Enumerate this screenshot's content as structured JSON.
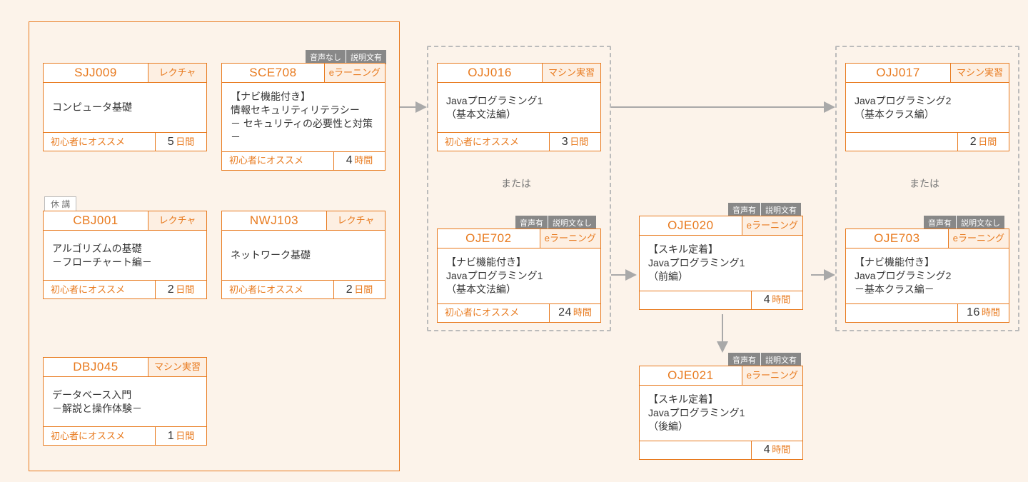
{
  "labels": {
    "or": "または",
    "suspended": "休 講",
    "recommended": "初心者にオススメ"
  },
  "badges": {
    "audio_no": "音声なし",
    "audio_yes": "音声有",
    "desc_yes": "説明文有",
    "desc_no": "説明文なし"
  },
  "units": {
    "days": "日間",
    "hours": "時間"
  },
  "types": {
    "lecture": "レクチャ",
    "elearning": "eラーニング",
    "machine": "マシン実習"
  },
  "courses": {
    "sjj009": {
      "code": "SJJ009",
      "type": "lecture",
      "title": "コンピュータ基礎",
      "rec": true,
      "dur": "5",
      "unit": "days"
    },
    "sce708": {
      "code": "SCE708",
      "type": "elearning",
      "title": "【ナビ機能付き】\n情報セキュリティリテラシー\n－ セキュリティの必要性と対策－",
      "rec": true,
      "dur": "4",
      "unit": "hours",
      "badges": [
        "audio_no",
        "desc_yes"
      ]
    },
    "cbj001": {
      "code": "CBJ001",
      "type": "lecture",
      "title": "アルゴリズムの基礎\n－フローチャート編－",
      "rec": true,
      "dur": "2",
      "unit": "days",
      "status": "suspended"
    },
    "nwj103": {
      "code": "NWJ103",
      "type": "lecture",
      "title": "ネットワーク基礎",
      "rec": true,
      "dur": "2",
      "unit": "days"
    },
    "dbj045": {
      "code": "DBJ045",
      "type": "machine",
      "title": "データベース入門\n－解説と操作体験－",
      "rec": true,
      "dur": "1",
      "unit": "days"
    },
    "ojj016": {
      "code": "OJJ016",
      "type": "machine",
      "title": "Javaプログラミング1\n（基本文法編）",
      "rec": true,
      "dur": "3",
      "unit": "days"
    },
    "oje702": {
      "code": "OJE702",
      "type": "elearning",
      "title": "【ナビ機能付き】\nJavaプログラミング1\n（基本文法編）",
      "rec": true,
      "dur": "24",
      "unit": "hours",
      "badges": [
        "audio_yes",
        "desc_no"
      ]
    },
    "oje020": {
      "code": "OJE020",
      "type": "elearning",
      "title": "【スキル定着】\nJavaプログラミング1\n（前編）",
      "rec": false,
      "dur": "4",
      "unit": "hours",
      "badges": [
        "audio_yes",
        "desc_yes"
      ]
    },
    "oje021": {
      "code": "OJE021",
      "type": "elearning",
      "title": "【スキル定着】\nJavaプログラミング1\n（後編）",
      "rec": false,
      "dur": "4",
      "unit": "hours",
      "badges": [
        "audio_yes",
        "desc_yes"
      ]
    },
    "ojj017": {
      "code": "OJJ017",
      "type": "machine",
      "title": "Javaプログラミング2\n（基本クラス編）",
      "rec": false,
      "dur": "2",
      "unit": "days"
    },
    "oje703": {
      "code": "OJE703",
      "type": "elearning",
      "title": "【ナビ機能付き】\nJavaプログラミング2\n－基本クラス編－",
      "rec": false,
      "dur": "16",
      "unit": "hours",
      "badges": [
        "audio_yes",
        "desc_no"
      ]
    }
  }
}
